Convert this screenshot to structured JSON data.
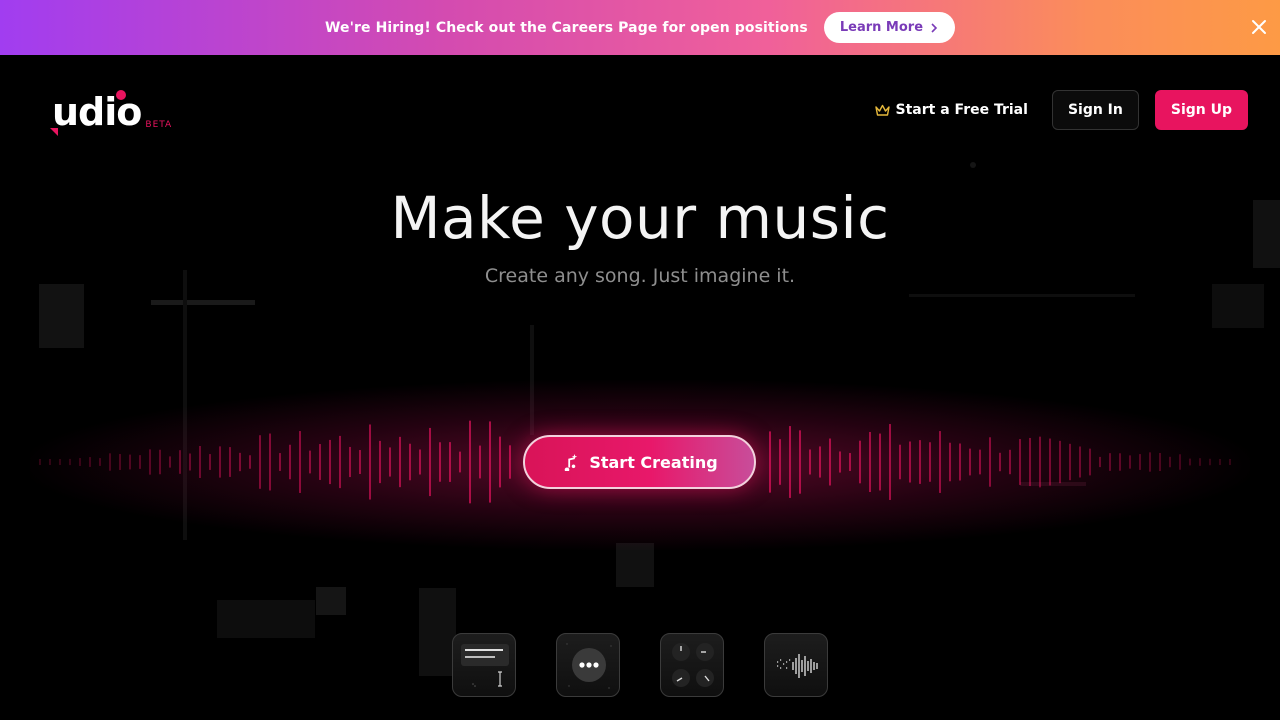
{
  "banner": {
    "message": "We're Hiring! Check out the Careers Page for open positions",
    "button_label": "Learn More",
    "close_icon": "close-icon",
    "gradient": [
      "#a13df0",
      "#fd9a45"
    ]
  },
  "header": {
    "logo_text": "udio",
    "logo_badge": "BETA",
    "trial_label": "Start a Free Trial",
    "trial_icon": "crown-icon",
    "signin_label": "Sign In",
    "signup_label": "Sign Up"
  },
  "hero": {
    "title": "Make your music",
    "subtitle": "Create any song. Just imagine it.",
    "cta_label": "Start Creating",
    "cta_icon": "music-note-sparkle-icon"
  },
  "feature_tiles": [
    {
      "icon": "text-input-icon"
    },
    {
      "icon": "chat-bubble-icon"
    },
    {
      "icon": "knobs-icon"
    },
    {
      "icon": "waveform-icon"
    }
  ],
  "colors": {
    "accent": "#e8145f",
    "background": "#000000",
    "subtitle": "#8e8e8e"
  }
}
